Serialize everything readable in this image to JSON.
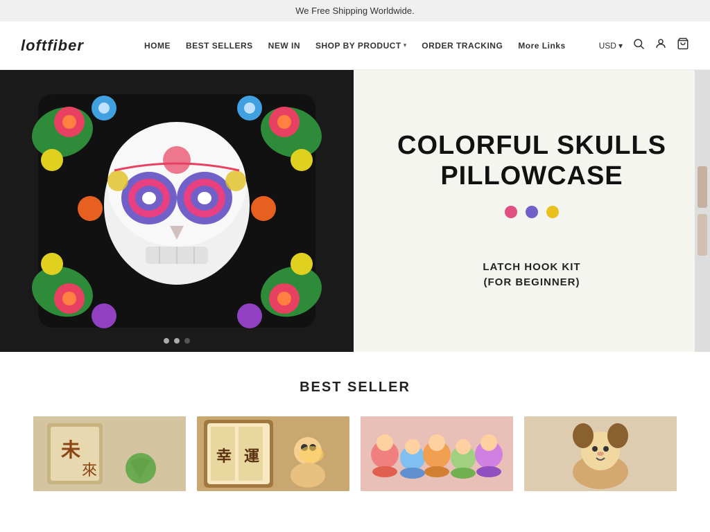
{
  "announcement": {
    "text": "We Free Shipping Worldwide."
  },
  "header": {
    "logo": "loftfiber",
    "nav": [
      {
        "label": "HOME",
        "href": "#",
        "hasDropdown": false
      },
      {
        "label": "BEST SELLERS",
        "href": "#",
        "hasDropdown": false
      },
      {
        "label": "NEW IN",
        "href": "#",
        "hasDropdown": false
      },
      {
        "label": "SHOP BY PRODUCT",
        "href": "#",
        "hasDropdown": true
      },
      {
        "label": "ORDER TRACKING",
        "href": "#",
        "hasDropdown": false
      },
      {
        "label": "More Links",
        "href": "#",
        "hasDropdown": false
      }
    ],
    "currency": "USD",
    "currency_arrow": "▾"
  },
  "hero": {
    "title": "COLORFUL SKULLS PILLOWCASE",
    "dots": [
      {
        "color": "#e05080"
      },
      {
        "color": "#7060c8"
      },
      {
        "color": "#e8c020"
      }
    ],
    "subtitle": "LATCH HOOK KIT\n(FOR BEGINNER)",
    "carousel_dots": [
      {
        "active": false
      },
      {
        "active": false
      },
      {
        "active": true
      }
    ]
  },
  "best_seller": {
    "title": "BEST SELLER",
    "products": [
      {
        "id": 1,
        "alt": "Calligraphy craft product"
      },
      {
        "id": 2,
        "alt": "Figurine craft product"
      },
      {
        "id": 3,
        "alt": "Colorful dolls product"
      },
      {
        "id": 4,
        "alt": "Animal doll product"
      }
    ]
  },
  "icons": {
    "search": "🔍",
    "account": "👤",
    "cart": "🛒",
    "dropdown_arrow": "▾"
  }
}
